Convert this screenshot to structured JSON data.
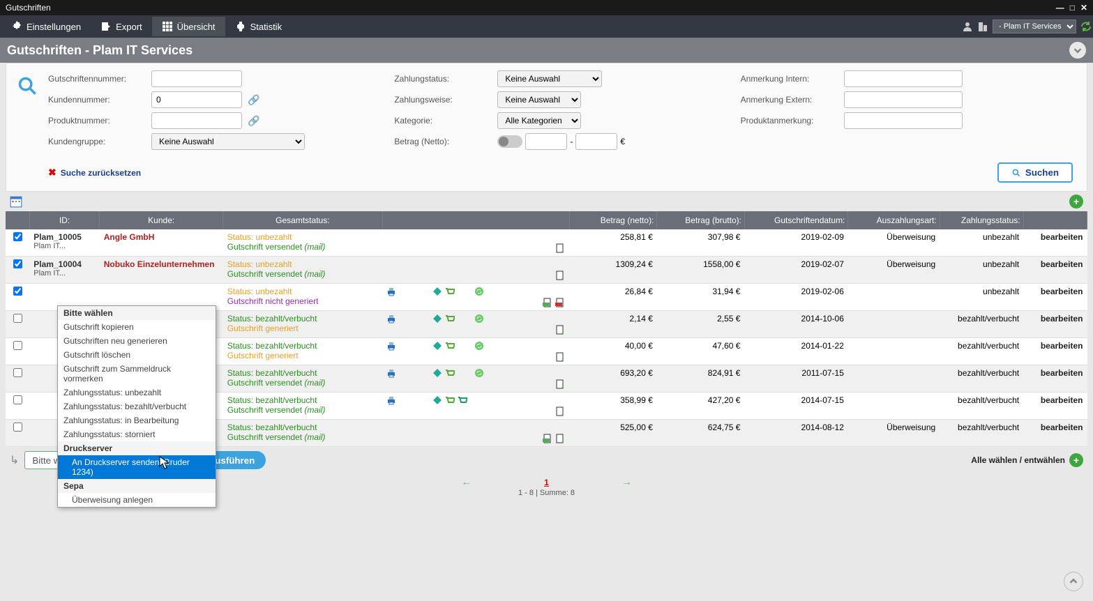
{
  "window": {
    "title": "Gutschriften"
  },
  "menubar": {
    "items": [
      {
        "label": "Einstellungen"
      },
      {
        "label": "Export"
      },
      {
        "label": "Übersicht"
      },
      {
        "label": "Statistik"
      }
    ],
    "org_select": "- Plam IT Services"
  },
  "page_title": "Gutschriften - Plam IT Services",
  "search": {
    "labels": {
      "gutschriftennummer": "Gutschriftennummer:",
      "kundennummer": "Kundennummer:",
      "produktnummer": "Produktnummer:",
      "kundengruppe": "Kundengruppe:",
      "zahlungstatus": "Zahlungstatus:",
      "zahlungsweise": "Zahlungsweise:",
      "kategorie": "Kategorie:",
      "betrag": "Betrag (Netto):",
      "anmerkung_intern": "Anmerkung Intern:",
      "anmerkung_extern": "Anmerkung Extern:",
      "produktanmerkung": "Produktanmerkung:"
    },
    "values": {
      "kundennummer": "0",
      "kundengruppe": "Keine Auswahl",
      "zahlungstatus": "Keine Auswahl",
      "zahlungsweise": "Keine Auswahl",
      "kategorie": "Alle Kategorien"
    },
    "reset": "Suche zurücksetzen",
    "submit": "Suchen",
    "currency": "€",
    "dash": "-"
  },
  "table": {
    "headers": {
      "id": "ID:",
      "kunde": "Kunde:",
      "status": "Gesamtstatus:",
      "netto": "Betrag (netto):",
      "brutto": "Betrag (brutto):",
      "datum": "Gutschriftendatum:",
      "auszahlung": "Auszahlungsart:",
      "zstatus": "Zahlungsstatus:"
    },
    "edit_label": "bearbeiten",
    "status_prefix": "Status: ",
    "rows": [
      {
        "checked": true,
        "id": "Plam_10005",
        "sub": "Plam IT...",
        "kunde": "Angle GmbH",
        "s1": "unbezahlt",
        "s1c": "st-orange",
        "s2": "Gutschrift versendet",
        "s2c": "st-green",
        "s2p": "(mail)",
        "netto": "258,81 €",
        "brutto": "307,98 €",
        "datum": "2019-02-09",
        "aus": "Überweisung",
        "zst": "unbezahlt",
        "odd": false
      },
      {
        "checked": true,
        "id": "Plam_10004",
        "sub": "Plam IT...",
        "kunde": "Nobuko Einzelunternehmen",
        "s1": "unbezahlt",
        "s1c": "st-orange",
        "s2": "Gutschrift versendet",
        "s2c": "st-green",
        "s2p": "(mail)",
        "netto": "1309,24 €",
        "brutto": "1558,00 €",
        "datum": "2019-02-07",
        "aus": "Überweisung",
        "zst": "unbezahlt",
        "odd": true
      },
      {
        "checked": true,
        "id": "",
        "sub": "",
        "kunde": "",
        "s1": "unbezahlt",
        "s1c": "st-orange",
        "s2": "Gutschrift nicht generiert",
        "s2c": "st-purple",
        "s2p": "",
        "netto": "26,84 €",
        "brutto": "31,94 €",
        "datum": "2019-02-06",
        "aus": "",
        "zst": "unbezahlt",
        "odd": false
      },
      {
        "checked": false,
        "id": "",
        "sub": "",
        "kunde": "",
        "s1": "bezahlt/verbucht",
        "s1c": "st-green",
        "s2": "Gutschrift generiert",
        "s2c": "st-orange",
        "s2p": "",
        "netto": "2,14 €",
        "brutto": "2,55 €",
        "datum": "2014-10-06",
        "aus": "",
        "zst": "bezahlt/verbucht",
        "odd": true
      },
      {
        "checked": false,
        "id": "",
        "sub": "",
        "kunde": "",
        "s1": "bezahlt/verbucht",
        "s1c": "st-green",
        "s2": "Gutschrift generiert",
        "s2c": "st-orange",
        "s2p": "",
        "netto": "40,00 €",
        "brutto": "47,60 €",
        "datum": "2014-01-22",
        "aus": "",
        "zst": "bezahlt/verbucht",
        "odd": false
      },
      {
        "checked": false,
        "id": "",
        "sub": "",
        "kunde": "",
        "s1": "bezahlt/verbucht",
        "s1c": "st-green",
        "s2": "Gutschrift versendet",
        "s2c": "st-green",
        "s2p": "(mail)",
        "netto": "693,20 €",
        "brutto": "824,91 €",
        "datum": "2011-07-15",
        "aus": "",
        "zst": "bezahlt/verbucht",
        "odd": true
      },
      {
        "checked": false,
        "id": "",
        "sub": "",
        "kunde": "",
        "s1": "bezahlt/verbucht",
        "s1c": "st-green",
        "s2": "Gutschrift versendet",
        "s2c": "st-green",
        "s2p": "(mail)",
        "netto": "358,99 €",
        "brutto": "427,20 €",
        "datum": "2014-07-15",
        "aus": "",
        "zst": "bezahlt/verbucht",
        "odd": false
      },
      {
        "checked": false,
        "id": "",
        "sub": "",
        "kunde": "",
        "s1": "bezahlt/verbucht",
        "s1c": "st-green",
        "s2": "Gutschrift versendet",
        "s2c": "st-green",
        "s2p": "(mail)",
        "netto": "525,00 €",
        "brutto": "624,75 €",
        "datum": "2014-08-12",
        "aus": "Überweisung",
        "zst": "bezahlt/verbucht",
        "odd": true
      }
    ]
  },
  "context_menu": {
    "items": [
      {
        "label": "Bitte wählen",
        "type": "header"
      },
      {
        "label": "Gutschrift kopieren",
        "type": "item"
      },
      {
        "label": "Gutschriften neu generieren",
        "type": "item"
      },
      {
        "label": "Gutschrift löschen",
        "type": "item"
      },
      {
        "label": "Gutschrift zum Sammeldruck vormerken",
        "type": "item"
      },
      {
        "label": "Zahlungsstatus: unbezahlt",
        "type": "item"
      },
      {
        "label": "Zahlungsstatus: bezahlt/verbucht",
        "type": "item"
      },
      {
        "label": "Zahlungsstatus: in Bearbeitung",
        "type": "item"
      },
      {
        "label": "Zahlungsstatus: storniert",
        "type": "item"
      },
      {
        "label": "Druckserver",
        "type": "header"
      },
      {
        "label": "An Druckserver senden (Bruder 1234)",
        "type": "highlighted"
      },
      {
        "label": "Sepa",
        "type": "header"
      },
      {
        "label": "Überweisung anlegen",
        "type": "indent"
      }
    ]
  },
  "action_bar": {
    "select_value": "Bitte wählen",
    "exec": "Ausführen",
    "select_all": "Alle wählen / entwählen"
  },
  "pagination": {
    "page": "1",
    "summary": "1 - 8 | Summe: 8"
  }
}
